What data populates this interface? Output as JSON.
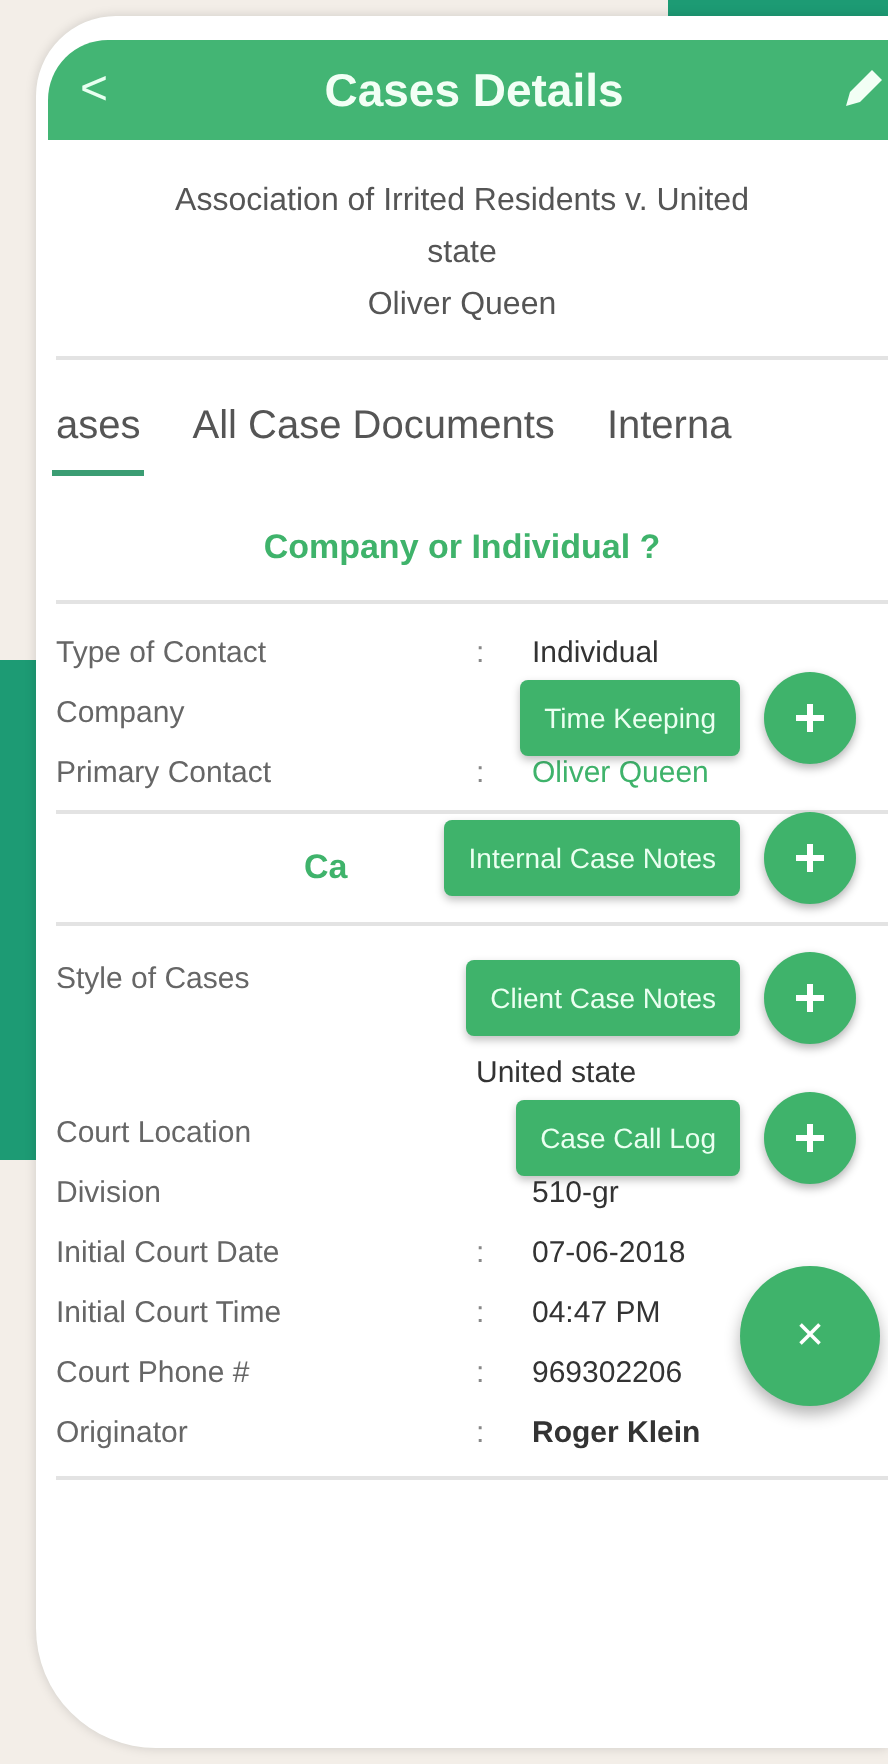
{
  "header": {
    "back": "<",
    "title": "Cases Details"
  },
  "case": {
    "title": "Association of Irrited Residents v. United state",
    "client": "Oliver Queen"
  },
  "tabs": [
    {
      "label": "ases",
      "selected": true
    },
    {
      "label": "All Case Documents",
      "selected": false
    },
    {
      "label": "Interna",
      "selected": false
    }
  ],
  "section_heading": "Company or Individual ?",
  "contact_rows": [
    {
      "label": "Type of Contact",
      "separator": ":",
      "value": "Individual",
      "kind": "text"
    },
    {
      "label": "Company",
      "kind": "hidden"
    },
    {
      "label": "Primary Contact",
      "separator": ":",
      "value": "Oliver Queen",
      "kind": "link"
    }
  ],
  "second_heading": "Ca",
  "case_rows": [
    {
      "label": "Style of Cases",
      "value": "United state",
      "kind": "tall"
    },
    {
      "label": "Court Location",
      "kind": "hidden"
    },
    {
      "label": "Division",
      "value": "510-gr",
      "kind": "text"
    },
    {
      "label": "Initial Court Date",
      "separator": ":",
      "value": "07-06-2018",
      "kind": "text"
    },
    {
      "label": "Initial Court Time",
      "separator": ":",
      "value": "04:47 PM",
      "kind": "text"
    },
    {
      "label": "Court Phone #",
      "separator": ":",
      "value": "969302206",
      "kind": "text"
    },
    {
      "label": "Originator",
      "separator": ":",
      "value": "Roger Klein",
      "kind": "bold"
    }
  ],
  "fab_actions": [
    {
      "label": "Time Keeping"
    },
    {
      "label": "Internal Case Notes"
    },
    {
      "label": "Client Case Notes"
    },
    {
      "label": "Case Call Log"
    }
  ],
  "fab_close": "×"
}
